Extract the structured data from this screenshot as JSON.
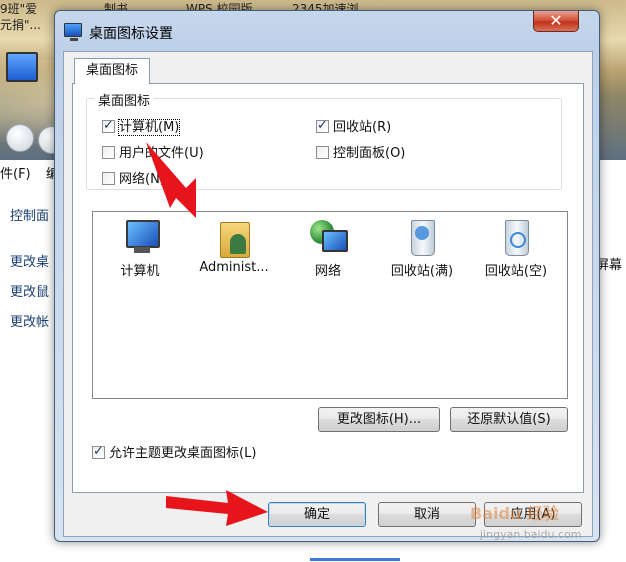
{
  "background": {
    "top_snippets": [
      "9班\"爱",
      "制书",
      "WPS 校园版",
      "2345加速浏",
      "元捐\"..."
    ],
    "menu_file": "件(F)",
    "menu_partial": "编",
    "left_links": [
      "控制面",
      "更改桌",
      "更改鼠",
      "更改帐"
    ],
    "right_partial": "屏幕"
  },
  "dialog": {
    "title": "桌面图标设置",
    "close_glyph": "✕",
    "tab_label": "桌面图标",
    "group_title": "桌面图标",
    "checkboxes": [
      {
        "label": "计算机(M)",
        "checked": true
      },
      {
        "label": "用户的文件(U)",
        "checked": false
      },
      {
        "label": "网络(N)",
        "checked": false
      },
      {
        "label": "回收站(R)",
        "checked": true
      },
      {
        "label": "控制面板(O)",
        "checked": false
      }
    ],
    "icons": [
      {
        "label": "计算机",
        "icon": "computer-icon"
      },
      {
        "label": "Administ...",
        "icon": "user-folder-icon"
      },
      {
        "label": "网络",
        "icon": "network-icon"
      },
      {
        "label": "回收站(满)",
        "icon": "recycle-bin-full-icon"
      },
      {
        "label": "回收站(空)",
        "icon": "recycle-bin-empty-icon"
      }
    ],
    "change_icon_button": "更改图标(H)...",
    "restore_default_button": "还原默认值(S)",
    "allow_theme_checkbox": {
      "label": "允许主题更改桌面图标(L)",
      "checked": true
    },
    "ok_button": "确定",
    "cancel_button": "取消",
    "apply_button": "应用(A)"
  },
  "watermark": {
    "text": "Baidu 经验",
    "sub": "jingyan.baidu.com"
  },
  "colors": {
    "arrow": "#e8141c",
    "accent": "#3c7fb1"
  }
}
